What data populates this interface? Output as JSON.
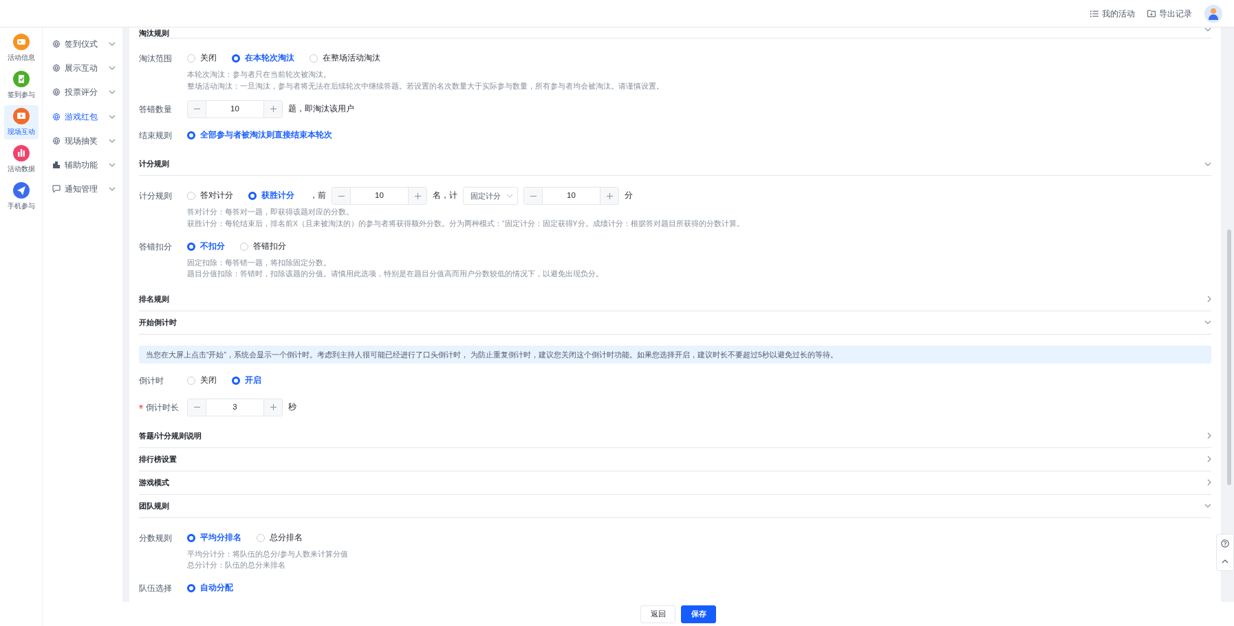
{
  "header": {
    "links": [
      {
        "label": "我的活动"
      },
      {
        "label": "导出记录"
      }
    ]
  },
  "rail": [
    {
      "label": "活动信息",
      "selected": false,
      "color": "#f7931e"
    },
    {
      "label": "签到参与",
      "selected": false,
      "color": "#4caf29"
    },
    {
      "label": "现场互动",
      "selected": true,
      "color": "#f26b2a"
    },
    {
      "label": "活动数据",
      "selected": false,
      "color": "#f0446b"
    },
    {
      "label": "手机参与",
      "selected": false,
      "color": "#3b6cf0"
    }
  ],
  "menu": [
    {
      "label": "签到仪式",
      "selected": false
    },
    {
      "label": "展示互动",
      "selected": false
    },
    {
      "label": "投票评分",
      "selected": false
    },
    {
      "label": "游戏红包",
      "selected": true
    },
    {
      "label": "现场抽奖",
      "selected": false
    },
    {
      "label": "辅助功能",
      "selected": false
    },
    {
      "label": "通知管理",
      "selected": false
    }
  ],
  "sections": [
    {
      "title": "淘汰规则",
      "expanded": true,
      "fields": [
        {
          "label": "淘汰范围",
          "controls": [
            {
              "kind": "radio",
              "label": "关闭",
              "selected": false
            },
            {
              "kind": "radio",
              "label": "在本轮次淘汰",
              "selected": true
            },
            {
              "kind": "radio",
              "label": "在整场活动淘汰",
              "selected": false
            }
          ],
          "help": [
            "本轮次淘汰：参与者只在当前轮次被淘汰。",
            "整场活动淘汰：一旦淘汰，参与者将无法在后续轮次中继续答题。若设置的名次数量大于实际参与数量，所有参与者均会被淘汰。请谨慎设置。"
          ]
        },
        {
          "label": "答错数量",
          "controls": [
            {
              "kind": "stepper",
              "value": "10"
            },
            {
              "kind": "text",
              "text": "题，即淘汰该用户"
            }
          ]
        },
        {
          "label": "结束规则",
          "controls": [
            {
              "kind": "radio",
              "label": "全部参与者被淘汰则直接结束本轮次",
              "selected": true
            }
          ]
        }
      ]
    },
    {
      "title": "计分规则",
      "expanded": true,
      "fields": [
        {
          "label": "计分规则",
          "controls": [
            {
              "kind": "radio",
              "label": "答对计分",
              "selected": false
            },
            {
              "kind": "radio",
              "label": "获胜计分",
              "selected": true
            },
            {
              "kind": "text",
              "text": "，前"
            },
            {
              "kind": "stepper",
              "value": "10"
            },
            {
              "kind": "text",
              "text": "名，计"
            },
            {
              "kind": "select",
              "value": "固定计分"
            },
            {
              "kind": "stepper",
              "value": "10"
            },
            {
              "kind": "text",
              "text": "分"
            }
          ],
          "help": [
            "答对计分：每答对一题，即获得该题对应的分数。",
            "获胜计分：每轮结束后，排名前X（且未被淘汰的）的参与者将获得额外分数。分为两种模式：“固定计分：固定获得Y分。成绩计分：根据答对题目所获得的分数计算。"
          ]
        },
        {
          "label": "答错扣分",
          "controls": [
            {
              "kind": "radio",
              "label": "不扣分",
              "selected": true
            },
            {
              "kind": "radio",
              "label": "答错扣分",
              "selected": false
            }
          ],
          "help": [
            "固定扣除：每答错一题，将扣除固定分数。",
            "题目分值扣除：答错时，扣除该题的分值。请慎用此选项，特别是在题目分值高而用户分数较低的情况下，以避免出现负分。"
          ]
        }
      ]
    },
    {
      "title": "排名规则",
      "expanded": false
    },
    {
      "title": "开始倒计时",
      "expanded": true,
      "notice": "当您在大屏上点击“开始”，系统会显示一个倒计时。考虑到主持人很可能已经进行了口头倒计时， 为防止重复倒计时，建议您关闭这个倒计时功能。如果您选择开启，建议时长不要超过5秒以避免过长的等待。",
      "fields": [
        {
          "label": "倒计时",
          "controls": [
            {
              "kind": "radio",
              "label": "关闭",
              "selected": false
            },
            {
              "kind": "radio",
              "label": "开启",
              "selected": true
            }
          ]
        },
        {
          "label": "倒计时长",
          "required": true,
          "controls": [
            {
              "kind": "stepper",
              "value": "3"
            },
            {
              "kind": "text",
              "text": "秒"
            }
          ]
        }
      ]
    },
    {
      "title": "答题/计分规则说明",
      "expanded": false
    },
    {
      "title": "排行榜设置",
      "expanded": false
    },
    {
      "title": "游戏模式",
      "expanded": false
    },
    {
      "title": "团队规则",
      "expanded": true,
      "fields": [
        {
          "label": "分数规则",
          "controls": [
            {
              "kind": "radio",
              "label": "平均分排名",
              "selected": true
            },
            {
              "kind": "radio",
              "label": "总分排名",
              "selected": false
            }
          ],
          "help": [
            "平均分计分：将队伍的总分/参与人数来计算分值",
            "总分计分：队伍的总分来排名"
          ]
        },
        {
          "label": "队伍选择",
          "controls": [
            {
              "kind": "radio",
              "label": "自动分配",
              "selected": true
            }
          ]
        }
      ]
    }
  ],
  "footer": {
    "buttons": [
      {
        "label": "返回",
        "kind": "secondary"
      },
      {
        "label": "保存",
        "kind": "primary"
      }
    ]
  }
}
